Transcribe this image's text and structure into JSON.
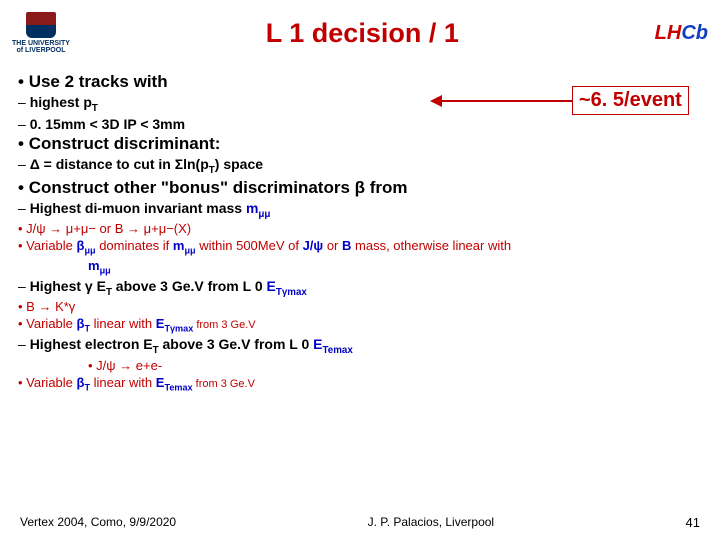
{
  "header": {
    "uni_line1": "THE UNIVERSITY",
    "uni_line2": "of LIVERPOOL",
    "title": "L 1 decision / 1",
    "lhcb": {
      "l": "L",
      "h": "H",
      "c": "C",
      "b": "b"
    }
  },
  "callout": "~6. 5/event",
  "body": {
    "use2": "Use 2 tracks with",
    "pt": "highest p",
    "pt_sub": "T",
    "ip": "0. 15mm < 3D IP < 3mm",
    "construct": "Construct discriminant:",
    "delta": "Δ = distance to cut in Σln(p",
    "delta_sub": "T",
    "delta_end": ") space",
    "bonus": "Construct other \"bonus\" discriminators β from",
    "dimuon": "Highest di-muon invariant mass ",
    "mmm": "m",
    "mmm_sub": "μμ",
    "jpsi_line": "J/ψ → μ+μ−  or  B → μ+μ−(X)",
    "var_bmm1": "Variable ",
    "var_bmm2": " dominates if ",
    "var_bmm3": " within 500MeV of ",
    "var_bmm_jpsi": "J/ψ",
    "var_bmm4": " or ",
    "var_bmm_B": "B",
    "var_bmm5": " mass, otherwise linear with",
    "bmm": "β",
    "bmm_sub": "μμ",
    "gamma_line": "Highest γ E",
    "gamma_sub": "T",
    "gamma_rest": " above 3 Ge.V from L 0 ",
    "et_gmax": "E",
    "et_gmax_sub": "Tγmax",
    "b_kstar": "B → K*γ",
    "var_bT1": "Variable ",
    "bT": "β",
    "bT_sub": "T",
    "var_bT2": " linear with ",
    "var_bT3": " from 3 Ge.V",
    "elec_line": "Highest electron E",
    "elec_rest": " above 3 Ge.V from L 0 ",
    "et_emax": "E",
    "et_emax_sub": "Temax",
    "jpsi_ee": "J/ψ → e+e-"
  },
  "footer": {
    "left": "Vertex 2004, Como, 9/9/2020",
    "center": "J. P. Palacios, Liverpool",
    "page": "41"
  }
}
